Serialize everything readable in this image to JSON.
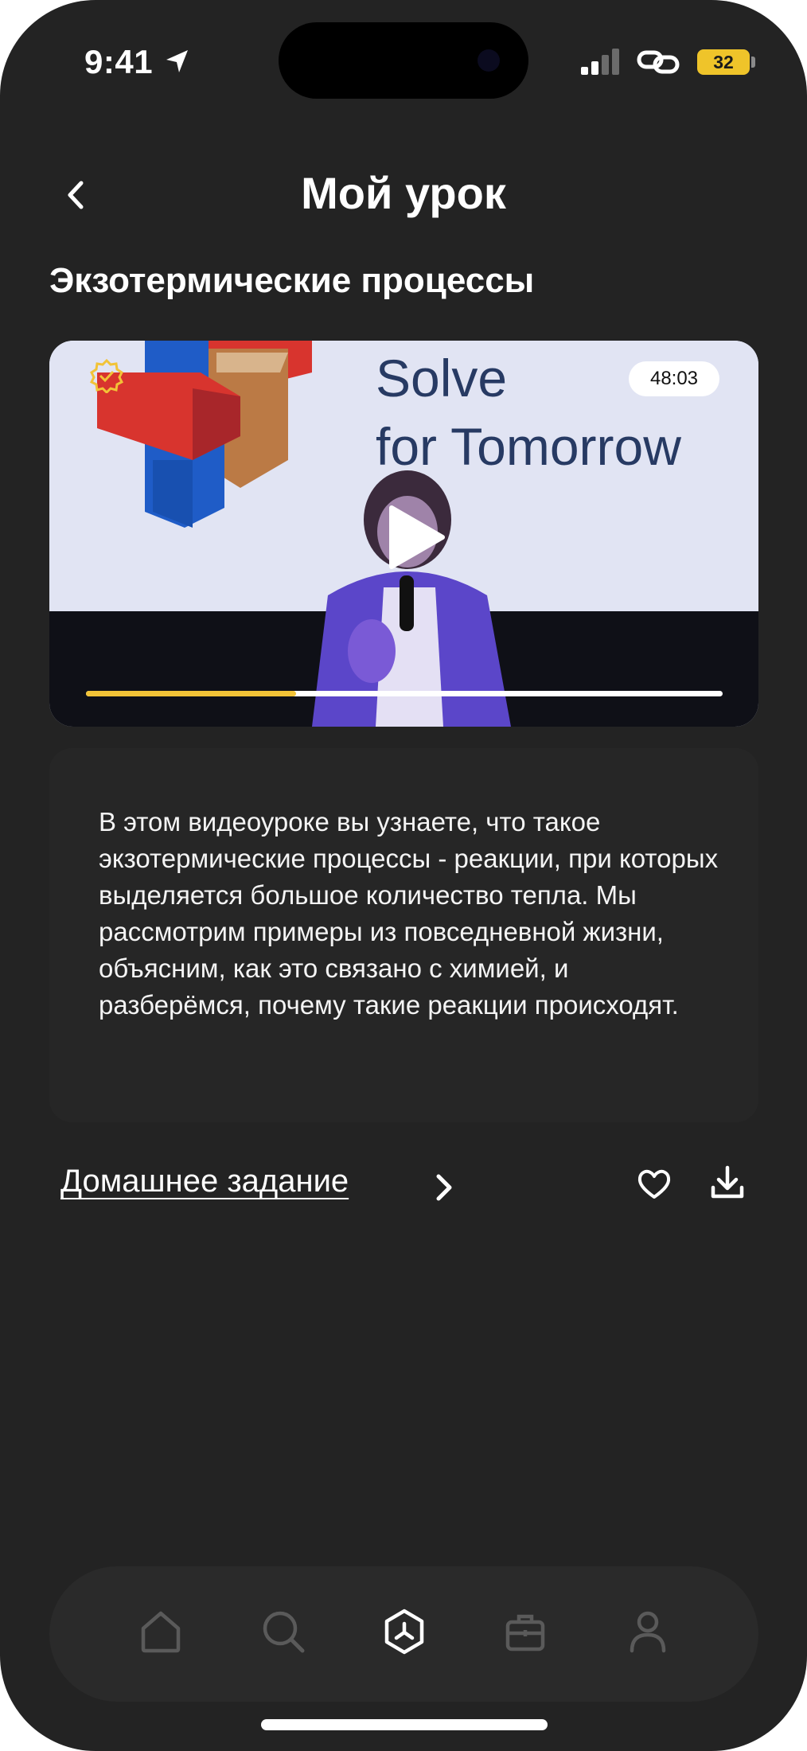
{
  "status_bar": {
    "time": "9:41",
    "battery": "32",
    "icons": [
      "location-arrow-icon",
      "cell-signal-icon",
      "link-icon",
      "battery-icon"
    ]
  },
  "header": {
    "title": "Мой урок",
    "back_icon": "chevron-left-icon"
  },
  "lesson": {
    "title": "Экзотермические процессы",
    "video": {
      "slide_text_line1": "Solve",
      "slide_text_line2": "for Tomorrow",
      "duration": "48:03",
      "progress": 0.33,
      "progress_color": "#f2c337"
    },
    "description": "В этом видеоуроке вы узнаете, что такое экзотермические процессы - реакции, при которых выделяется большое количество тепла. Мы рассмотрим примеры из повседневной жизни, объясним, как это связано с химией, и разберёмся, почему такие реакции происходят."
  },
  "homework": {
    "label": "Домашнее задание",
    "icons": [
      "chevron-right-icon",
      "heart-icon",
      "download-icon"
    ]
  },
  "tabbar": {
    "items": [
      {
        "icon": "home-icon",
        "active": false
      },
      {
        "icon": "search-icon",
        "active": false
      },
      {
        "icon": "hexagon-logo-icon",
        "active": true
      },
      {
        "icon": "toolbox-icon",
        "active": false
      },
      {
        "icon": "profile-icon",
        "active": false
      }
    ]
  },
  "colors": {
    "background": "#232323",
    "accent": "#f2c337",
    "inactive_icon": "#5a5a5a",
    "active_icon": "#ffffff"
  }
}
